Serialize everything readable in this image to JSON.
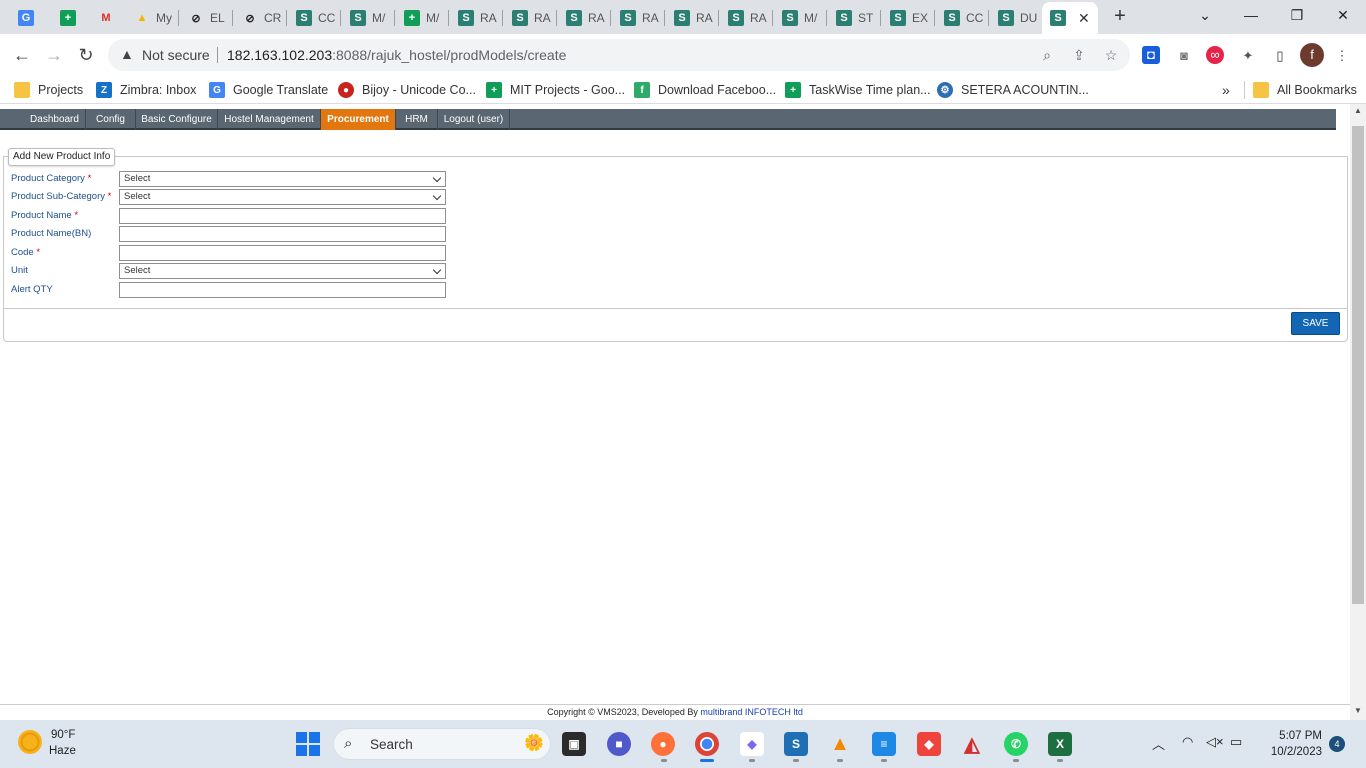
{
  "browser": {
    "tabs": [
      {
        "title": "",
        "icon": "google-translate-icon"
      },
      {
        "title": "",
        "icon": "sheets-icon"
      },
      {
        "title": "",
        "icon": "gmail-icon"
      },
      {
        "title": "My",
        "icon": "drive-icon"
      },
      {
        "title": "EL",
        "icon": "blocked-icon"
      },
      {
        "title": "CR",
        "icon": "blocked-icon"
      },
      {
        "title": "CC",
        "icon": "site-icon"
      },
      {
        "title": "M/",
        "icon": "site-icon"
      },
      {
        "title": "M/",
        "icon": "sheets-icon"
      },
      {
        "title": "RA",
        "icon": "site-icon"
      },
      {
        "title": "RA",
        "icon": "site-icon"
      },
      {
        "title": "RA",
        "icon": "site-icon"
      },
      {
        "title": "RA",
        "icon": "site-icon"
      },
      {
        "title": "RA",
        "icon": "site-icon"
      },
      {
        "title": "RA",
        "icon": "site-icon"
      },
      {
        "title": "M/",
        "icon": "site-icon"
      },
      {
        "title": "ST",
        "icon": "site-icon"
      },
      {
        "title": "EX",
        "icon": "site-icon"
      },
      {
        "title": "CC",
        "icon": "site-icon"
      },
      {
        "title": "DU",
        "icon": "site-icon"
      },
      {
        "title": "",
        "icon": "site-icon",
        "active": true
      }
    ],
    "address": {
      "security_label": "Not secure",
      "url_host": "182.163.102.203",
      "url_rest": ":8088/rajuk_hostel/prodModels/create"
    },
    "profile_initial": "f",
    "bookmarks": [
      {
        "label": "Projects",
        "icon": "folder-icon"
      },
      {
        "label": "Zimbra: Inbox",
        "icon": "zimbra-icon"
      },
      {
        "label": "Google Translate",
        "icon": "google-translate-icon"
      },
      {
        "label": "Bijoy - Unicode Co...",
        "icon": "bijoy-icon"
      },
      {
        "label": "MIT Projects - Goo...",
        "icon": "sheets-icon"
      },
      {
        "label": "Download Faceboo...",
        "icon": "facebook-icon"
      },
      {
        "label": "TaskWise Time plan...",
        "icon": "sheets-icon"
      },
      {
        "label": "SETERA ACOUNTIN...",
        "icon": "gear-icon"
      }
    ],
    "bookmarks_overflow": "»",
    "all_bookmarks": "All Bookmarks"
  },
  "menu": {
    "items": [
      "Dashboard",
      "Config",
      "Basic Configure",
      "Hostel Management",
      "Procurement",
      "HRM",
      "Logout (user)"
    ],
    "active": "Procurement"
  },
  "form": {
    "legend": "Add New Product Info",
    "fields": [
      {
        "label": "Product Category",
        "required_mark": "*",
        "type": "select",
        "value": "Select"
      },
      {
        "label": "Product Sub-Category",
        "required_mark": "*",
        "type": "select",
        "value": "Select"
      },
      {
        "label": "Product Name",
        "required_mark": "*",
        "type": "text",
        "value": ""
      },
      {
        "label": "Product Name(BN)",
        "required_mark": "",
        "type": "text",
        "value": ""
      },
      {
        "label": "Code",
        "required_mark": "*",
        "type": "text",
        "value": ""
      },
      {
        "label": "Unit",
        "required_mark": "",
        "type": "select",
        "value": "Select"
      },
      {
        "label": "Alert QTY",
        "required_mark": "",
        "type": "text",
        "value": ""
      }
    ],
    "save_label": "SAVE"
  },
  "footer": {
    "copyright": "Copyright © VMS2023, Developed By ",
    "developer": "multibrand INFOTECH ltd"
  },
  "taskbar": {
    "temperature": "90°F",
    "condition": "Haze",
    "search_placeholder": "Search",
    "time": "5:07 PM",
    "date": "10/2/2023",
    "notification_count": "4",
    "apps": [
      "file-explorer-icon",
      "teams-meet-icon",
      "firefox-icon",
      "chrome-icon",
      "clickup-icon",
      "s-app-icon",
      "vlc-icon",
      "notepad-icon",
      "anydesk-icon",
      "web-app-icon",
      "whatsapp-icon",
      "excel-icon"
    ]
  },
  "colors": {
    "menu_bg": "#5a6672",
    "menu_active": "#e2770f",
    "label_text": "#1e4f8e",
    "save_button": "#1266b3"
  }
}
